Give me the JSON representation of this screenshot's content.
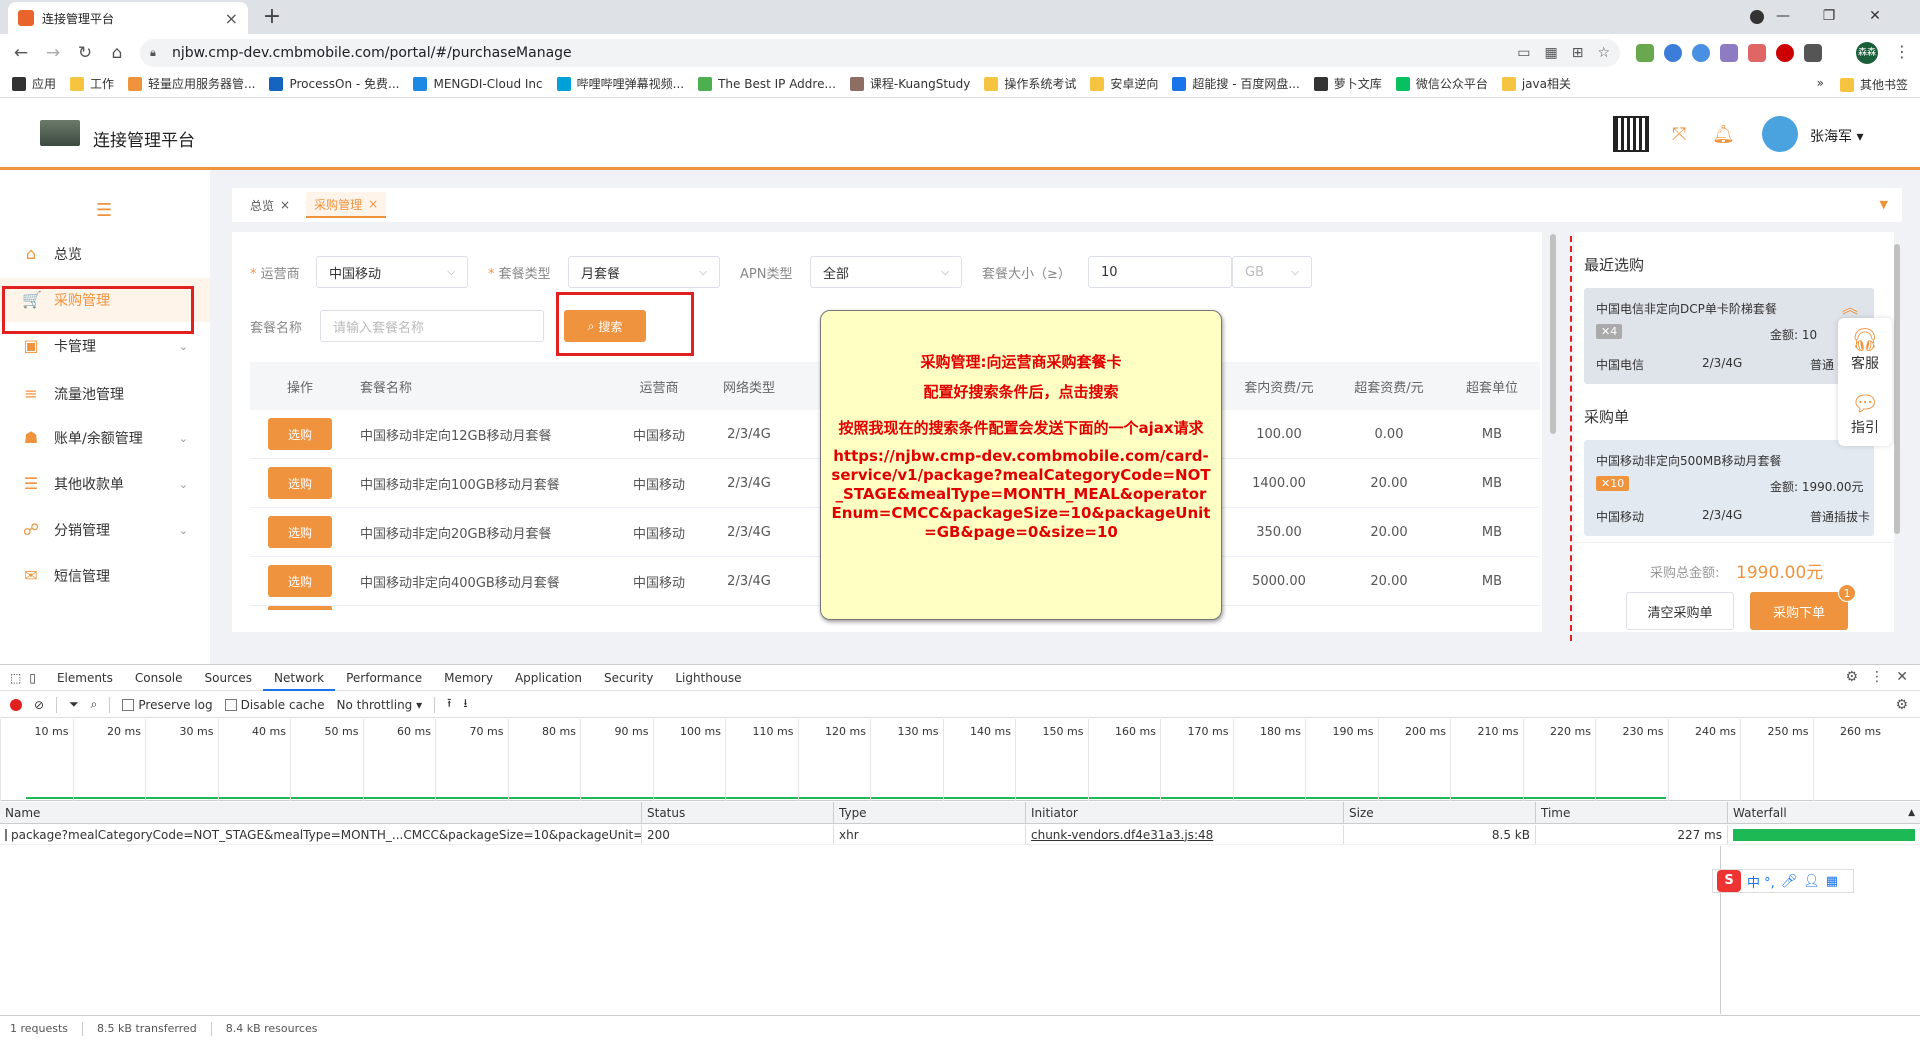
{
  "browser": {
    "tab_title": "连接管理平台",
    "tab_close": "×",
    "new_tab": "+",
    "url": "njbw.cmp-dev.cmpmobile.com/portal/#/purchaseManage",
    "url_display": "njbw.cmp-dev.cmbmobile.com/portal/#/purchaseManage",
    "profile_initials": "森森",
    "bookmarks": [
      "应用",
      "工作",
      "轻量应用服务器管...",
      "ProcessOn - 免费...",
      "MENGDI-Cloud Inc",
      "哔哩哔哩弹幕视频...",
      "The Best IP Addre...",
      "课程-KuangStudy",
      "操作系统考试",
      "安卓逆向",
      "超能搜 - 百度网盘...",
      "萝卜文库",
      "微信公众平台",
      "java相关"
    ],
    "bookmarks_more": "»",
    "bookmarks_other": "其他书签"
  },
  "app": {
    "title": "连接管理平台",
    "username": "张海军",
    "username_caret": "▾"
  },
  "sidebar": {
    "items": [
      {
        "label": "总览",
        "icon": "home-icon",
        "glyph": "⌂",
        "caret": ""
      },
      {
        "label": "采购管理",
        "icon": "cart-icon",
        "glyph": "🛒",
        "caret": ""
      },
      {
        "label": "卡管理",
        "icon": "card-icon",
        "glyph": "▣",
        "caret": "⌄"
      },
      {
        "label": "流量池管理",
        "icon": "database-icon",
        "glyph": "≡",
        "caret": ""
      },
      {
        "label": "账单/余额管理",
        "icon": "wallet-icon",
        "glyph": "☗",
        "caret": "⌄"
      },
      {
        "label": "其他收款单",
        "icon": "receipt-icon",
        "glyph": "☰",
        "caret": "⌄"
      },
      {
        "label": "分销管理",
        "icon": "share-icon",
        "glyph": "☍",
        "caret": "⌄"
      },
      {
        "label": "短信管理",
        "icon": "sms-icon",
        "glyph": "✉",
        "caret": ""
      }
    ]
  },
  "page_tabs": [
    {
      "label": "总览",
      "close": "×"
    },
    {
      "label": "采购管理",
      "close": "×"
    }
  ],
  "filters": {
    "operator_label": "运营商",
    "operator_value": "中国移动",
    "meal_type_label": "套餐类型",
    "meal_type_value": "月套餐",
    "apn_label": "APN类型",
    "apn_value": "全部",
    "size_label": "套餐大小（≥）",
    "size_value": "10",
    "size_unit": "GB",
    "name_label": "套餐名称",
    "name_placeholder": "请输入套餐名称",
    "search_label": "搜索",
    "required_mark": "*"
  },
  "table": {
    "headers": [
      "操作",
      "套餐名称",
      "运营商",
      "网络类型",
      "套内资费/元",
      "超套资费/元",
      "超套单位"
    ],
    "rows": [
      {
        "action": "选购",
        "name": "中国移动非定向12GB移动月套餐",
        "operator": "中国移动",
        "network": "2/3/4G",
        "price": "100.00",
        "over_price": "0.00",
        "unit": "MB"
      },
      {
        "action": "选购",
        "name": "中国移动非定向100GB移动月套餐",
        "operator": "中国移动",
        "network": "2/3/4G",
        "price": "1400.00",
        "over_price": "20.00",
        "unit": "MB"
      },
      {
        "action": "选购",
        "name": "中国移动非定向20GB移动月套餐",
        "operator": "中国移动",
        "network": "2/3/4G",
        "price": "350.00",
        "over_price": "20.00",
        "unit": "MB"
      },
      {
        "action": "选购",
        "name": "中国移动非定向400GB移动月套餐",
        "operator": "中国移动",
        "network": "2/3/4G",
        "price": "5000.00",
        "over_price": "20.00",
        "unit": "MB"
      }
    ]
  },
  "note": {
    "line1": "采购管理:向运营商采购套餐卡",
    "line2": "配置好搜索条件后，点击搜索",
    "line3": "按照我现在的搜索条件配置会发送下面的一个ajax请求",
    "url": "https://njbw.cmp-dev.combmobile.com/card-service/v1/package?mealCategoryCode=NOT_STAGE&mealType=MONTH_MEAL&operatorEnum=CMCC&packageSize=10&packageUnit=GB&page=0&size=10"
  },
  "right_panel": {
    "recent_title": "最近选购",
    "recent": {
      "name": "中国电信非定向DCP单卡阶梯套餐",
      "qty": "✕4",
      "amount_label": "金额:",
      "amount": "10",
      "operator": "中国电信",
      "network": "2/3/4G",
      "type": "普通"
    },
    "cart_title": "采购单",
    "cart": {
      "name": "中国移动非定向500MB移动月套餐",
      "qty": "✕10",
      "amount_label": "金额:",
      "amount": "1990.00元",
      "operator": "中国移动",
      "network": "2/3/4G",
      "type": "普通插拔卡"
    },
    "total_label": "采购总金额:",
    "total": "1990.00元",
    "clear_label": "清空采购单",
    "order_label": "采购下单",
    "order_badge": "1",
    "service_label": "客服",
    "guide_label": "指引"
  },
  "devtools": {
    "tabs": [
      "Elements",
      "Console",
      "Sources",
      "Network",
      "Performance",
      "Memory",
      "Application",
      "Security",
      "Lighthouse"
    ],
    "preserve_log": "Preserve log",
    "disable_cache": "Disable cache",
    "throttling": "No throttling",
    "ticks": [
      "10 ms",
      "20 ms",
      "30 ms",
      "40 ms",
      "50 ms",
      "60 ms",
      "70 ms",
      "80 ms",
      "90 ms",
      "100 ms",
      "110 ms",
      "120 ms",
      "130 ms",
      "140 ms",
      "150 ms",
      "160 ms",
      "170 ms",
      "180 ms",
      "190 ms",
      "200 ms",
      "210 ms",
      "220 ms",
      "230 ms",
      "240 ms",
      "250 ms",
      "260 ms"
    ],
    "columns": [
      "Name",
      "Status",
      "Type",
      "Initiator",
      "Size",
      "Time",
      "Waterfall"
    ],
    "request": {
      "name": "package?mealCategoryCode=NOT_STAGE&mealType=MONTH_...CMCC&packageSize=10&packageUnit=GB&pa...",
      "status": "200",
      "type": "xhr",
      "initiator": "chunk-vendors.df4e31a3.js:48",
      "size": "8.5 kB",
      "time": "227 ms"
    },
    "status_bar": [
      "1 requests",
      "8.5 kB transferred",
      "8.4 kB resources"
    ],
    "ime_label": "中 °,"
  }
}
